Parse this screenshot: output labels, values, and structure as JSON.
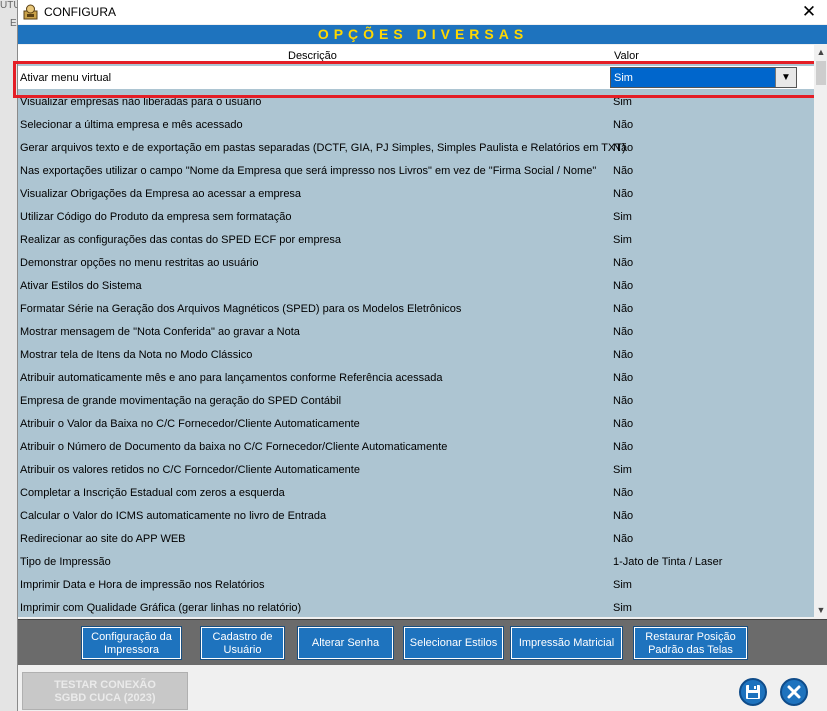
{
  "background": {
    "ghost_text_1": "UTU",
    "ghost_text_2": "E"
  },
  "window": {
    "title": "CONFIGURA",
    "close_glyph": "✕"
  },
  "section": {
    "title": "OPÇÕES DIVERSAS"
  },
  "columns": {
    "description": "Descrição",
    "value": "Valor"
  },
  "selected_row": {
    "description": "Ativar menu virtual",
    "value": "Sim"
  },
  "rows": [
    {
      "description": "Visualizar empresas não liberadas para o usuário",
      "value": "Sim"
    },
    {
      "description": "Selecionar a última empresa e mês acessado",
      "value": "Não"
    },
    {
      "description": "Gerar arquivos texto e de exportação em pastas separadas (DCTF, GIA, PJ Simples, Simples Paulista e Relatórios em TXT)",
      "value": "Não"
    },
    {
      "description": "Nas exportações utilizar o campo \"Nome da Empresa que será impresso nos Livros\" em vez de \"Firma Social / Nome\"",
      "value": "Não"
    },
    {
      "description": "Visualizar Obrigações da Empresa ao acessar a empresa",
      "value": "Não"
    },
    {
      "description": "Utilizar Código do Produto da empresa sem formatação",
      "value": "Sim"
    },
    {
      "description": "Realizar as configurações das contas do SPED ECF por empresa",
      "value": "Sim"
    },
    {
      "description": "Demonstrar opções no menu restritas ao usuário",
      "value": "Não"
    },
    {
      "description": "Ativar Estilos do Sistema",
      "value": "Não"
    },
    {
      "description": "Formatar Série na Geração dos Arquivos Magnéticos (SPED) para os Modelos Eletrônicos",
      "value": "Não"
    },
    {
      "description": "Mostrar mensagem de \"Nota Conferida\" ao gravar a Nota",
      "value": "Não"
    },
    {
      "description": "Mostrar tela de Itens da Nota no Modo Clássico",
      "value": "Não"
    },
    {
      "description": "Atribuir automaticamente mês e ano para lançamentos conforme Referência acessada",
      "value": "Não"
    },
    {
      "description": "Empresa de grande movimentação na geração do SPED Contábil",
      "value": "Não"
    },
    {
      "description": "Atribuir o Valor da Baixa no C/C Fornecedor/Cliente Automaticamente",
      "value": "Não"
    },
    {
      "description": "Atribuir o Número de Documento da baixa no C/C Fornecedor/Cliente Automaticamente",
      "value": "Não"
    },
    {
      "description": "Atribuir os valores retidos no C/C Forncedor/Cliente Automaticamente",
      "value": "Sim"
    },
    {
      "description": "Completar a Inscrição Estadual com zeros a esquerda",
      "value": "Não"
    },
    {
      "description": "Calcular o Valor do ICMS automaticamente no livro de Entrada",
      "value": "Não"
    },
    {
      "description": "Redirecionar ao site do APP WEB",
      "value": "Não"
    },
    {
      "description": "Tipo de Impressão",
      "value": "1-Jato de Tinta / Laser"
    },
    {
      "description": "Imprimir Data e Hora de impressão nos Relatórios",
      "value": "Sim"
    },
    {
      "description": "Imprimir com Qualidade Gráfica (gerar linhas no relatório)",
      "value": "Sim"
    }
  ],
  "toolbar": {
    "buttons": [
      {
        "name": "printer-config-button",
        "line1": "Configuração da",
        "line2": "Impressora"
      },
      {
        "name": "user-registration-button",
        "line1": "Cadastro de",
        "line2": "Usuário"
      },
      {
        "name": "change-password-button",
        "line1": "Alterar Senha",
        "line2": ""
      },
      {
        "name": "select-styles-button",
        "line1": "Selecionar Estilos",
        "line2": ""
      },
      {
        "name": "matrix-printing-button",
        "line1": "Impressão Matricial",
        "line2": ""
      },
      {
        "name": "restore-screen-position-button",
        "line1": "Restaurar Posição",
        "line2": "Padrão das Telas"
      }
    ]
  },
  "footer": {
    "test_connection_line1": "TESTAR CONEXÃO",
    "test_connection_line2": "SGBD CUCA (2023)"
  },
  "colors": {
    "accent_blue": "#1e73be",
    "header_text_yellow": "#ffd800",
    "grid_background": "#adc5d2",
    "highlight_red": "#e41e26"
  },
  "icons": [
    "app-icon",
    "close-icon",
    "dropdown-arrow-icon",
    "scroll-up-icon",
    "scroll-down-icon",
    "save-icon",
    "exit-icon"
  ]
}
